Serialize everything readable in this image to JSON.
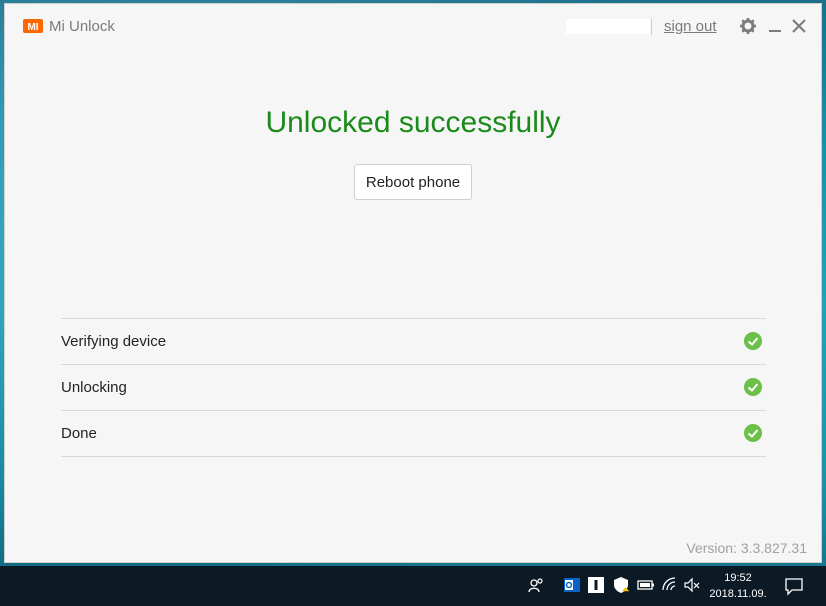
{
  "window": {
    "app_name": "Mi Unlock",
    "logo_text": "MI",
    "account": "",
    "sign_out": "sign out"
  },
  "main": {
    "headline": "Unlocked successfully",
    "reboot_button": "Reboot phone",
    "steps": [
      {
        "label": "Verifying device",
        "status": "done"
      },
      {
        "label": "Unlocking",
        "status": "done"
      },
      {
        "label": "Done",
        "status": "done"
      }
    ],
    "version": "Version: 3.3.827.31"
  },
  "taskbar": {
    "time": "19:52",
    "date": "2018.11.09."
  },
  "colors": {
    "success": "#1a8a1a",
    "check": "#6cc04a",
    "brand": "#ff6700"
  },
  "icons": [
    "mi-logo-icon",
    "gear-icon",
    "minimize-icon",
    "close-icon",
    "check-circle-icon",
    "people-icon",
    "outlook-icon",
    "calendar-icon",
    "shield-icon",
    "battery-icon",
    "wifi-icon",
    "mute-icon",
    "notification-icon"
  ]
}
